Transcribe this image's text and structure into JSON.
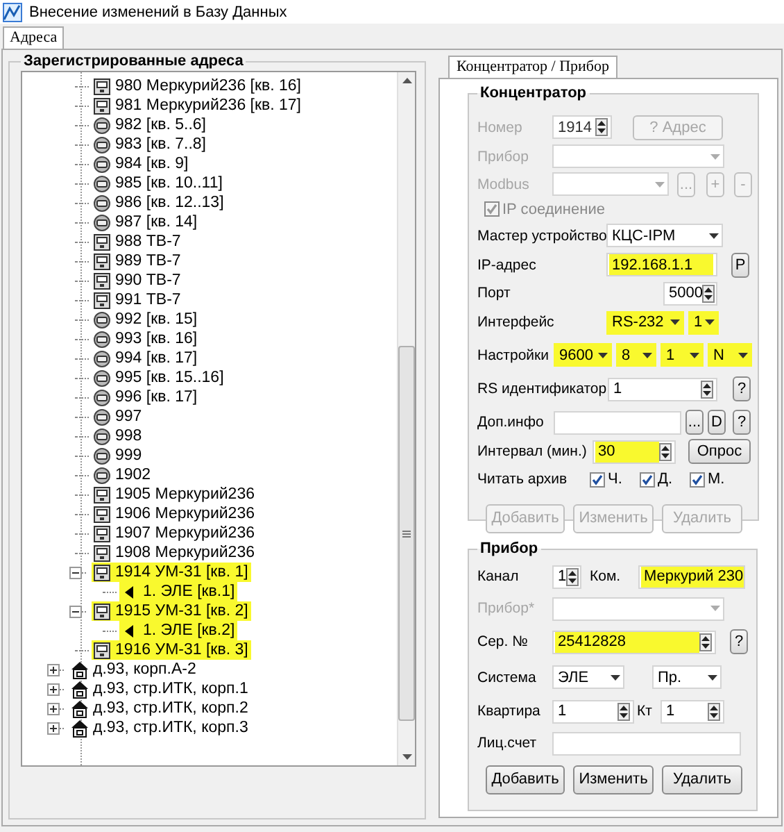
{
  "window": {
    "title": "Внесение изменений в Базу Данных"
  },
  "tabs": [
    {
      "label": "Адреса",
      "selected": true
    }
  ],
  "addresses": {
    "title": "Зарегистрированные адреса",
    "tree": {
      "nodes": [
        {
          "kind": "meter",
          "label": "980 Меркурий236 [кв. 16]",
          "highlighted": false
        },
        {
          "kind": "meter",
          "label": "981 Меркурий236 [кв. 17]",
          "highlighted": false
        },
        {
          "kind": "round",
          "label": "982 [кв. 5..6]",
          "highlighted": false
        },
        {
          "kind": "round",
          "label": "983 [кв. 7..8]",
          "highlighted": false
        },
        {
          "kind": "round",
          "label": "984 [кв. 9]",
          "highlighted": false
        },
        {
          "kind": "round",
          "label": "985 [кв. 10..11]",
          "highlighted": false
        },
        {
          "kind": "round",
          "label": "986 [кв. 12..13]",
          "highlighted": false
        },
        {
          "kind": "round",
          "label": "987 [кв. 14]",
          "highlighted": false
        },
        {
          "kind": "meter",
          "label": "988 ТВ-7",
          "highlighted": false
        },
        {
          "kind": "meter",
          "label": "989 ТВ-7",
          "highlighted": false
        },
        {
          "kind": "meter",
          "label": "990 ТВ-7",
          "highlighted": false
        },
        {
          "kind": "meter",
          "label": "991 ТВ-7",
          "highlighted": false
        },
        {
          "kind": "round",
          "label": "992 [кв. 15]",
          "highlighted": false
        },
        {
          "kind": "round",
          "label": "993 [кв. 16]",
          "highlighted": false
        },
        {
          "kind": "round",
          "label": "994 [кв. 17]",
          "highlighted": false
        },
        {
          "kind": "round",
          "label": "995 [кв. 15..16]",
          "highlighted": false
        },
        {
          "kind": "round",
          "label": "996 [кв. 17]",
          "highlighted": false
        },
        {
          "kind": "round",
          "label": "997",
          "highlighted": false
        },
        {
          "kind": "round",
          "label": "998",
          "highlighted": false
        },
        {
          "kind": "round",
          "label": "999",
          "highlighted": false
        },
        {
          "kind": "round",
          "label": "1902",
          "highlighted": false
        },
        {
          "kind": "meter",
          "label": "1905 Меркурий236",
          "highlighted": false
        },
        {
          "kind": "meter",
          "label": "1906 Меркурий236",
          "highlighted": false
        },
        {
          "kind": "meter",
          "label": "1907 Меркурий236",
          "highlighted": false
        },
        {
          "kind": "meter",
          "label": "1908 Меркурий236",
          "highlighted": false
        },
        {
          "kind": "meter",
          "label": "1914 УМ-31 [кв. 1]",
          "highlighted": true,
          "expanded": true,
          "children": [
            {
              "kind": "channel",
              "label": "1. ЭЛЕ [кв.1]",
              "highlighted": true
            }
          ]
        },
        {
          "kind": "meter",
          "label": "1915 УМ-31 [кв. 2]",
          "highlighted": true,
          "expanded": true,
          "children": [
            {
              "kind": "channel",
              "label": "1. ЭЛЕ [кв.2]",
              "highlighted": true
            }
          ]
        },
        {
          "kind": "meter",
          "label": "1916 УМ-31 [кв. 3]",
          "highlighted": true
        }
      ],
      "buildings": [
        {
          "kind": "building",
          "label": "д.93, корп.А-2",
          "expanded": false
        },
        {
          "kind": "building",
          "label": "д.93, стр.ИТК, корп.1",
          "expanded": false
        },
        {
          "kind": "building",
          "label": "д.93, стр.ИТК, корп.2",
          "expanded": false
        },
        {
          "kind": "building",
          "label": "д.93, стр.ИТК, корп.3",
          "expanded": false
        }
      ]
    }
  },
  "panel_tabs": [
    {
      "label": "Концентратор / Прибор",
      "selected": true
    }
  ],
  "concentrator": {
    "title": "Концентратор",
    "rows": [
      {
        "label": "Номер",
        "disabled": true,
        "controls": [
          {
            "kind": "spin",
            "value": "1914",
            "disabled": true
          },
          {
            "kind": "button",
            "label": "? Адрес",
            "disabled": true
          }
        ]
      },
      {
        "label": "Прибор",
        "disabled": true,
        "controls": [
          {
            "kind": "select",
            "disabled": true
          }
        ]
      },
      {
        "label": "Modbus",
        "disabled": true,
        "controls": [
          {
            "kind": "select",
            "disabled": true
          },
          {
            "kind": "button",
            "label": "...",
            "disabled": true
          },
          {
            "kind": "button",
            "label": "+",
            "disabled": true
          },
          {
            "kind": "button",
            "label": "-",
            "disabled": true
          }
        ]
      },
      {
        "controls": [
          {
            "kind": "check",
            "label": "IP соединение",
            "checked": true,
            "disabled": true
          }
        ]
      },
      {
        "label": "Мастер устройство",
        "disabled": false,
        "controls": [
          {
            "kind": "select",
            "value": "КЦС-IPM",
            "disabled": false
          }
        ]
      },
      {
        "label": "IP-адрес",
        "disabled": false,
        "controls": [
          {
            "kind": "input",
            "value": "192.168.1.1",
            "highlighted": true
          },
          {
            "kind": "button",
            "label": "P",
            "disabled": false
          }
        ]
      },
      {
        "label": "Порт",
        "disabled": false,
        "controls": [
          {
            "kind": "spin",
            "value": "5000",
            "disabled": false
          }
        ]
      },
      {
        "label": "Интерфейс",
        "disabled": false,
        "controls": [
          {
            "kind": "select",
            "value": "RS-232",
            "highlighted": true
          },
          {
            "kind": "select",
            "value": "1",
            "highlighted": true
          }
        ]
      },
      {
        "label": "Настройки",
        "disabled": false,
        "controls": [
          {
            "kind": "select",
            "value": "9600",
            "highlighted": true
          },
          {
            "kind": "select",
            "value": "8",
            "highlighted": true
          },
          {
            "kind": "select",
            "value": "1",
            "highlighted": true
          },
          {
            "kind": "select",
            "value": "N",
            "highlighted": true
          }
        ]
      },
      {
        "label": "RS идентификатор",
        "disabled": false,
        "controls": [
          {
            "kind": "spin",
            "value": "1",
            "disabled": false
          },
          {
            "kind": "button",
            "label": "?",
            "disabled": false
          }
        ]
      },
      {
        "label": "Доп.инфо",
        "disabled": false,
        "controls": [
          {
            "kind": "input"
          },
          {
            "kind": "button",
            "label": "...",
            "disabled": false
          },
          {
            "kind": "button",
            "label": "D",
            "disabled": false
          },
          {
            "kind": "button",
            "label": "?",
            "disabled": false
          }
        ]
      },
      {
        "label": "Интервал (мин.)",
        "disabled": false,
        "controls": [
          {
            "kind": "spin",
            "value": "30",
            "highlighted": true
          },
          {
            "kind": "button",
            "label": "Опрос",
            "disabled": false
          }
        ]
      },
      {
        "label": "Читать архив",
        "disabled": false,
        "controls": [
          {
            "kind": "check",
            "label": "Ч.",
            "checked": true
          },
          {
            "kind": "check",
            "label": "Д.",
            "checked": true
          },
          {
            "kind": "check",
            "label": "М.",
            "checked": true
          }
        ]
      },
      {
        "controls": [
          {
            "kind": "button",
            "label": "Добавить",
            "disabled": true
          },
          {
            "kind": "button",
            "label": "Изменить",
            "disabled": true
          },
          {
            "kind": "button",
            "label": "Удалить",
            "disabled": true
          }
        ]
      }
    ]
  },
  "device": {
    "title": "Прибор",
    "rows": [
      {
        "label": "Канал",
        "disabled": false,
        "controls": [
          {
            "kind": "spin",
            "value": "1"
          },
          {
            "kind": "text",
            "label": "Ком."
          },
          {
            "kind": "input",
            "value": "Меркурий 230",
            "highlighted": true
          }
        ]
      },
      {
        "label": "Прибор*",
        "disabled": true,
        "controls": [
          {
            "kind": "select",
            "disabled": true
          }
        ]
      },
      {
        "label": "Сер. №",
        "disabled": false,
        "controls": [
          {
            "kind": "spin",
            "value": "25412828",
            "highlighted": true
          },
          {
            "kind": "button",
            "label": "?",
            "disabled": false
          }
        ]
      },
      {
        "label": "Система",
        "disabled": false,
        "controls": [
          {
            "kind": "select",
            "value": "ЭЛЕ"
          },
          {
            "kind": "select",
            "value": "Пр."
          }
        ]
      },
      {
        "label": "Квартира",
        "disabled": false,
        "controls": [
          {
            "kind": "spin",
            "value": "1"
          },
          {
            "kind": "text",
            "label": "Кт"
          },
          {
            "kind": "spin",
            "value": "1"
          }
        ]
      },
      {
        "label": "Лиц.счет",
        "disabled": false,
        "controls": [
          {
            "kind": "input"
          }
        ]
      },
      {
        "controls": [
          {
            "kind": "button",
            "label": "Добавить",
            "disabled": false
          },
          {
            "kind": "button",
            "label": "Изменить",
            "disabled": false
          },
          {
            "kind": "button",
            "label": "Удалить",
            "disabled": false
          }
        ]
      }
    ]
  }
}
